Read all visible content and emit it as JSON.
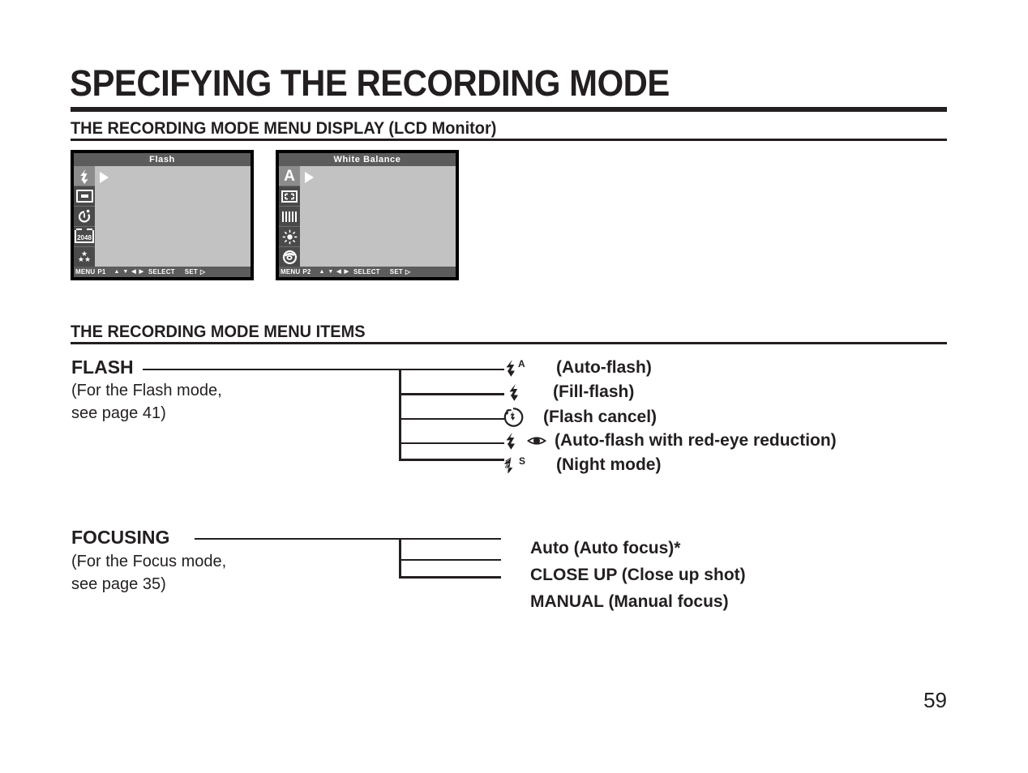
{
  "page": {
    "title": "SPECIFYING THE RECORDING MODE",
    "number": "59"
  },
  "sections": {
    "display": {
      "heading": "THE RECORDING MODE MENU DISPLAY (LCD Monitor)"
    },
    "items": {
      "heading": "THE RECORDING MODE MENU ITEMS"
    }
  },
  "lcd_screens": [
    {
      "title": "Flash",
      "icons": [
        {
          "name": "flash-icon",
          "glyph": "⚡",
          "selected": true
        },
        {
          "name": "frame-icon",
          "glyph": "",
          "selected": false
        },
        {
          "name": "self-timer-icon",
          "glyph": "↻",
          "selected": false
        },
        {
          "name": "resolution-2048-icon",
          "glyph": "2048",
          "selected": false
        },
        {
          "name": "quality-stars-icon",
          "glyph": "★",
          "selected": false
        }
      ],
      "bottom_bar": {
        "menu": "MENU",
        "page": "P1",
        "arrows": "▲ ▼ ◀ ▶",
        "select": "SELECT",
        "set": "SET",
        "set_arrow": "▷"
      }
    },
    {
      "title": "White Balance",
      "icons": [
        {
          "name": "auto-white-balance-icon",
          "glyph": "A",
          "selected": true
        },
        {
          "name": "focus-brackets-icon",
          "glyph": "",
          "selected": false
        },
        {
          "name": "fluorescent-icon",
          "glyph": "",
          "selected": false
        },
        {
          "name": "daylight-sun-icon",
          "glyph": "☀",
          "selected": false
        },
        {
          "name": "effect-camera-icon",
          "glyph": "◎",
          "selected": false
        }
      ],
      "bottom_bar": {
        "menu": "MENU",
        "page": "P2",
        "arrows": "▲ ▼ ◀ ▶",
        "select": "SELECT",
        "set": "SET",
        "set_arrow": "▷"
      }
    }
  ],
  "menu_items": [
    {
      "title": "FLASH",
      "note_line1": "(For the Flash mode,",
      "note_line2": "see page 41)",
      "options": [
        {
          "icon_name": "flash-auto-icon",
          "icon": "⚡",
          "sup": "A",
          "eye": "",
          "label": "(Auto-flash)"
        },
        {
          "icon_name": "flash-fill-icon",
          "icon": "⚡",
          "sup": "",
          "eye": "",
          "label": "(Fill-flash)"
        },
        {
          "icon_name": "flash-cancel-icon",
          "icon": "",
          "sup": "",
          "eye": "",
          "label": "(Flash cancel)"
        },
        {
          "icon_name": "flash-redeye-icon",
          "icon": "⚡",
          "sup": "",
          "eye": "◉",
          "label": "(Auto-flash with red-eye reduction)"
        },
        {
          "icon_name": "flash-night-icon",
          "icon": "⚡",
          "sup": "S",
          "eye": "",
          "label": "(Night mode)"
        }
      ]
    },
    {
      "title": "FOCUSING",
      "note_line1": "(For the Focus mode,",
      "note_line2": "see page 35)",
      "options": [
        {
          "label": "Auto (Auto focus)*"
        },
        {
          "label": "CLOSE UP  (Close up shot)"
        },
        {
          "label": "MANUAL (Manual focus)"
        }
      ]
    }
  ],
  "colors": {
    "ink": "#231f20",
    "lcd_titlebar": "#5c5c5c",
    "lcd_canvas": "#c2c2c2",
    "lcd_iconcol": "#4a4a4a",
    "lcd_selected": "#8c8c8c"
  }
}
